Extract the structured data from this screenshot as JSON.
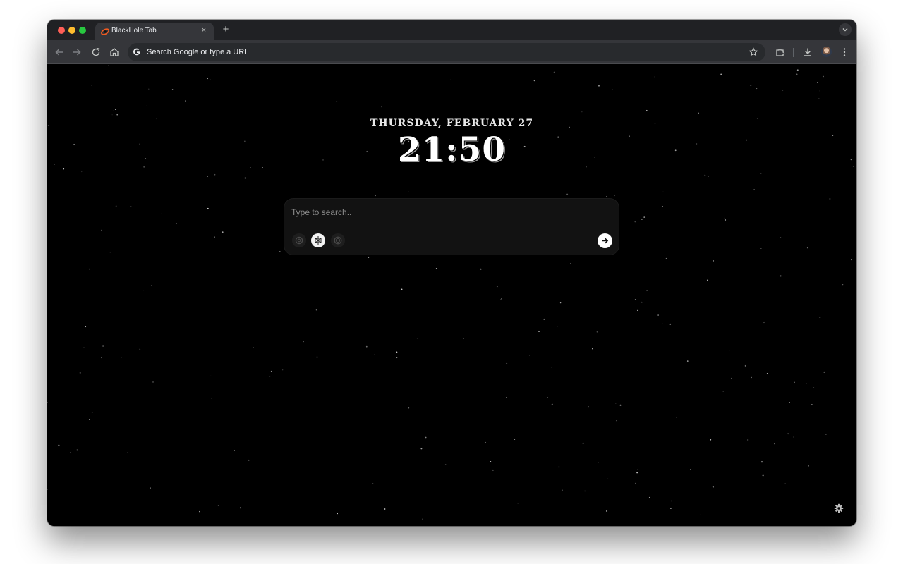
{
  "browser": {
    "tab": {
      "title": "BlackHole Tab",
      "close_glyph": "×",
      "favicon": "blackhole-icon"
    },
    "new_tab_glyph": "+",
    "omnibox": {
      "text": "Search Google or type a URL",
      "engine_icon": "google-g-icon"
    },
    "toolbar_icons": [
      "back-icon",
      "forward-icon",
      "reload-icon",
      "home-icon",
      "bookmark-star-icon",
      "extensions-icon",
      "download-icon",
      "profile-avatar",
      "menu-icon"
    ]
  },
  "page": {
    "date": "THURSDAY, FEBRUARY 27",
    "time": "21:50",
    "search": {
      "placeholder": "Type to search..",
      "engines": [
        "engine-openai-icon",
        "engine-perplexity-icon",
        "engine-gemini-icon"
      ]
    },
    "settings_icon": "gear-icon"
  },
  "colors": {
    "page_bg": "#000000",
    "tabstrip_bg": "#202124",
    "toolbar_bg": "#35363a",
    "search_card_bg": "#121212"
  }
}
